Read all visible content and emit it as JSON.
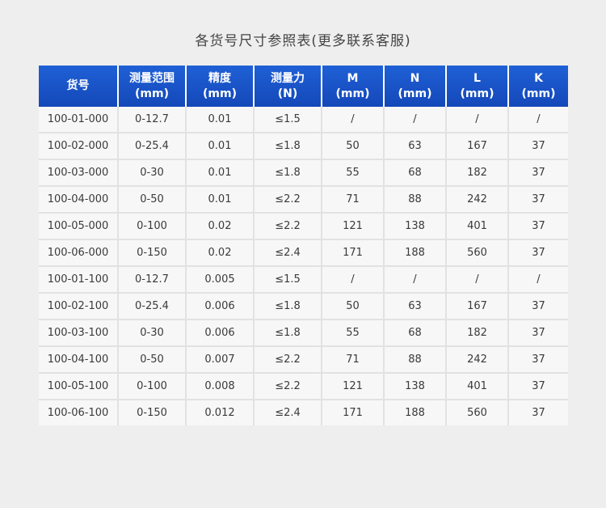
{
  "title": "各货号尺寸参照表(更多联系客服)",
  "table": {
    "headers": [
      [
        "货号"
      ],
      [
        "测量范围",
        "(mm)"
      ],
      [
        "精度",
        "(mm)"
      ],
      [
        "测量力",
        "(N)"
      ],
      [
        "M",
        "(mm)"
      ],
      [
        "N",
        "(mm)"
      ],
      [
        "L",
        "(mm)"
      ],
      [
        "K",
        "(mm)"
      ]
    ],
    "rows": [
      [
        "100-01-000",
        "0-12.7",
        "0.01",
        "≤1.5",
        "/",
        "/",
        "/",
        "/"
      ],
      [
        "100-02-000",
        "0-25.4",
        "0.01",
        "≤1.8",
        "50",
        "63",
        "167",
        "37"
      ],
      [
        "100-03-000",
        "0-30",
        "0.01",
        "≤1.8",
        "55",
        "68",
        "182",
        "37"
      ],
      [
        "100-04-000",
        "0-50",
        "0.01",
        "≤2.2",
        "71",
        "88",
        "242",
        "37"
      ],
      [
        "100-05-000",
        "0-100",
        "0.02",
        "≤2.2",
        "121",
        "138",
        "401",
        "37"
      ],
      [
        "100-06-000",
        "0-150",
        "0.02",
        "≤2.4",
        "171",
        "188",
        "560",
        "37"
      ],
      [
        "100-01-100",
        "0-12.7",
        "0.005",
        "≤1.5",
        "/",
        "/",
        "/",
        "/"
      ],
      [
        "100-02-100",
        "0-25.4",
        "0.006",
        "≤1.8",
        "50",
        "63",
        "167",
        "37"
      ],
      [
        "100-03-100",
        "0-30",
        "0.006",
        "≤1.8",
        "55",
        "68",
        "182",
        "37"
      ],
      [
        "100-04-100",
        "0-50",
        "0.007",
        "≤2.2",
        "71",
        "88",
        "242",
        "37"
      ],
      [
        "100-05-100",
        "0-100",
        "0.008",
        "≤2.2",
        "121",
        "138",
        "401",
        "37"
      ],
      [
        "100-06-100",
        "0-150",
        "0.012",
        "≤2.4",
        "171",
        "188",
        "560",
        "37"
      ]
    ]
  },
  "colors": {
    "header_bg": "#1a55c8",
    "header_text": "#ffffff",
    "cell_bg": "#f7f7f8",
    "page_bg": "#eeeeef"
  }
}
